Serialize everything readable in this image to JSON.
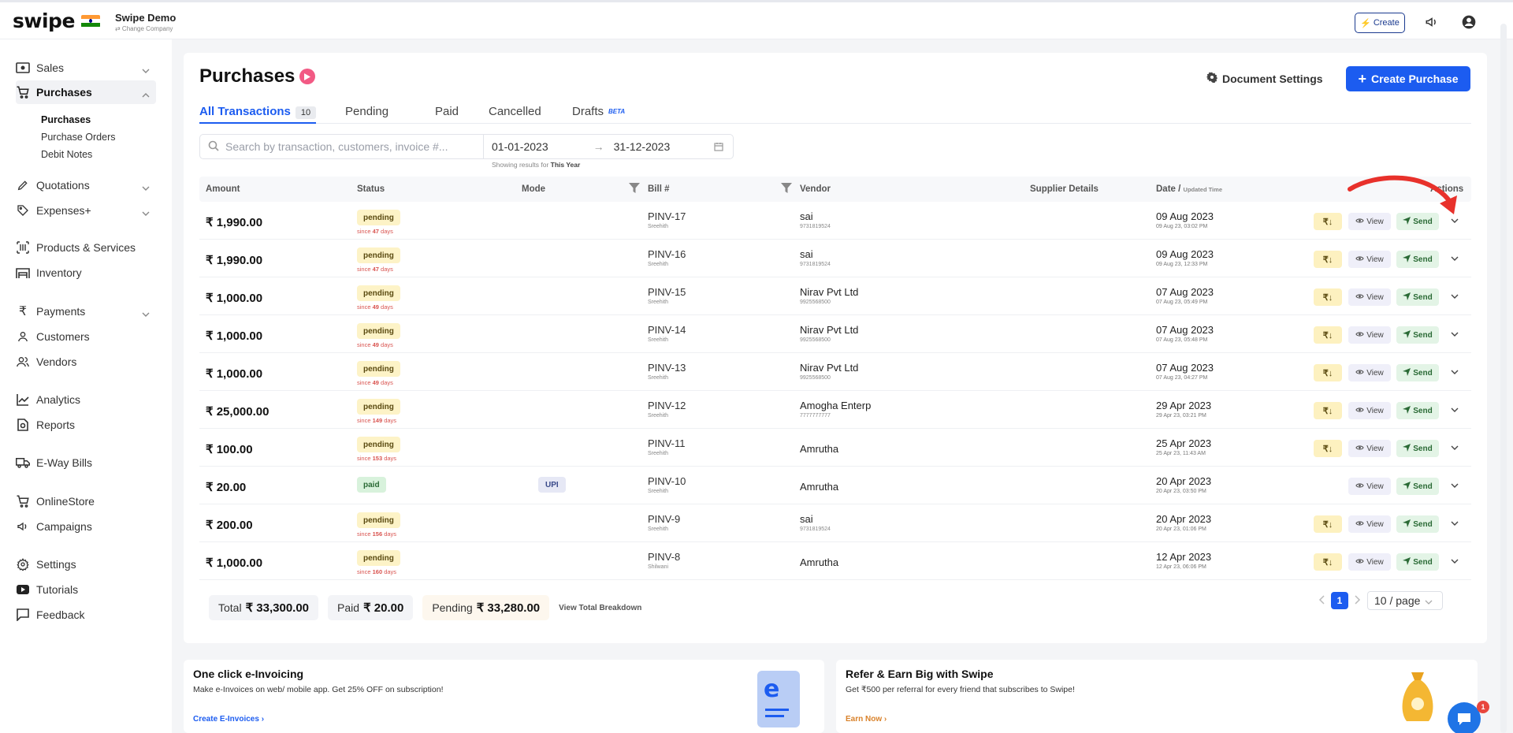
{
  "header": {
    "logo_text": "swipe",
    "company_name": "Swipe Demo",
    "change_company": "⇄ Change Company",
    "create_label": "Create"
  },
  "sidebar": {
    "sales": "Sales",
    "purchases": "Purchases",
    "sub_purchases": "Purchases",
    "sub_purchase_orders": "Purchase Orders",
    "sub_debit_notes": "Debit Notes",
    "quotations": "Quotations",
    "expenses": "Expenses+",
    "products": "Products & Services",
    "inventory": "Inventory",
    "payments": "Payments",
    "customers": "Customers",
    "vendors": "Vendors",
    "analytics": "Analytics",
    "reports": "Reports",
    "eway": "E-Way Bills",
    "onlinestore": "OnlineStore",
    "campaigns": "Campaigns",
    "settings": "Settings",
    "tutorials": "Tutorials",
    "feedback": "Feedback"
  },
  "page": {
    "title": "Purchases",
    "doc_settings": "Document Settings",
    "create_purchase": "Create Purchase"
  },
  "tabs": {
    "all": "All Transactions",
    "all_count": "10",
    "pending": "Pending",
    "paid": "Paid",
    "cancelled": "Cancelled",
    "drafts": "Drafts",
    "beta": "BETA"
  },
  "filters": {
    "search_placeholder": "Search by transaction, customers, invoice #...",
    "date_from": "01-01-2023",
    "date_to": "31-12-2023",
    "hint_prefix": "Showing results for",
    "hint_range": "This Year"
  },
  "columns": {
    "amount": "Amount",
    "status": "Status",
    "mode": "Mode",
    "bill": "Bill #",
    "vendor": "Vendor",
    "supplier": "Supplier Details",
    "date": "Date /",
    "date_small": "Updated Time",
    "actions": "Actions"
  },
  "actions": {
    "download": "₹↓",
    "view": "View",
    "send": "Send"
  },
  "rows": [
    {
      "amount": "₹ 1,990.00",
      "status": "pending",
      "since_prefix": "since",
      "since_days": "47",
      "since_suffix": "days",
      "mode": "",
      "bill": "PINV-17",
      "bill_by": "Sreehith",
      "vendor": "sai",
      "vendor_phone": "9731819524",
      "date": "09 Aug 2023",
      "time": "09 Aug 23, 03:02 PM"
    },
    {
      "amount": "₹ 1,990.00",
      "status": "pending",
      "since_prefix": "since",
      "since_days": "47",
      "since_suffix": "days",
      "mode": "",
      "bill": "PINV-16",
      "bill_by": "Sreehith",
      "vendor": "sai",
      "vendor_phone": "9731819524",
      "date": "09 Aug 2023",
      "time": "09 Aug 23, 12:33 PM"
    },
    {
      "amount": "₹ 1,000.00",
      "status": "pending",
      "since_prefix": "since",
      "since_days": "49",
      "since_suffix": "days",
      "mode": "",
      "bill": "PINV-15",
      "bill_by": "Sreehith",
      "vendor": "Nirav Pvt Ltd",
      "vendor_phone": "9925568500",
      "date": "07 Aug 2023",
      "time": "07 Aug 23, 05:49 PM"
    },
    {
      "amount": "₹ 1,000.00",
      "status": "pending",
      "since_prefix": "since",
      "since_days": "49",
      "since_suffix": "days",
      "mode": "",
      "bill": "PINV-14",
      "bill_by": "Sreehith",
      "vendor": "Nirav Pvt Ltd",
      "vendor_phone": "9925568500",
      "date": "07 Aug 2023",
      "time": "07 Aug 23, 05:48 PM"
    },
    {
      "amount": "₹ 1,000.00",
      "status": "pending",
      "since_prefix": "since",
      "since_days": "49",
      "since_suffix": "days",
      "mode": "",
      "bill": "PINV-13",
      "bill_by": "Sreehith",
      "vendor": "Nirav Pvt Ltd",
      "vendor_phone": "9925568500",
      "date": "07 Aug 2023",
      "time": "07 Aug 23, 04:27 PM"
    },
    {
      "amount": "₹ 25,000.00",
      "status": "pending",
      "since_prefix": "since",
      "since_days": "149",
      "since_suffix": "days",
      "mode": "",
      "bill": "PINV-12",
      "bill_by": "Sreehith",
      "vendor": "Amogha Enterp",
      "vendor_phone": "7777777777",
      "date": "29 Apr 2023",
      "time": "29 Apr 23, 03:21 PM"
    },
    {
      "amount": "₹ 100.00",
      "status": "pending",
      "since_prefix": "since",
      "since_days": "153",
      "since_suffix": "days",
      "mode": "",
      "bill": "PINV-11",
      "bill_by": "Sreehith",
      "vendor": "Amrutha",
      "vendor_phone": "",
      "date": "25 Apr 2023",
      "time": "25 Apr 23, 11:43 AM"
    },
    {
      "amount": "₹ 20.00",
      "status": "paid",
      "since_prefix": "",
      "since_days": "",
      "since_suffix": "",
      "mode": "UPI",
      "bill": "PINV-10",
      "bill_by": "Sreehith",
      "vendor": "Amrutha",
      "vendor_phone": "",
      "date": "20 Apr 2023",
      "time": "20 Apr 23, 03:50 PM"
    },
    {
      "amount": "₹ 200.00",
      "status": "pending",
      "since_prefix": "since",
      "since_days": "156",
      "since_suffix": "days",
      "mode": "",
      "bill": "PINV-9",
      "bill_by": "Sreehith",
      "vendor": "sai",
      "vendor_phone": "9731819524",
      "date": "20 Apr 2023",
      "time": "20 Apr 23, 01:06 PM"
    },
    {
      "amount": "₹ 1,000.00",
      "status": "pending",
      "since_prefix": "since",
      "since_days": "160",
      "since_suffix": "days",
      "mode": "",
      "bill": "PINV-8",
      "bill_by": "Shilwani",
      "vendor": "Amrutha",
      "vendor_phone": "",
      "date": "12 Apr 2023",
      "time": "12 Apr 23, 06:06 PM"
    }
  ],
  "totals": {
    "total_label": "Total",
    "total_value": "₹ 33,300.00",
    "paid_label": "Paid",
    "paid_value": "₹ 20.00",
    "pending_label": "Pending",
    "pending_value": "₹ 33,280.00",
    "breakdown": "View Total Breakdown"
  },
  "pagination": {
    "current": "1",
    "page_size": "10 / page"
  },
  "promos": {
    "einv_title": "One click e-Invoicing",
    "einv_text": "Make e-Invoices on web/ mobile app. Get 25% OFF on subscription!",
    "einv_link": "Create E-Invoices",
    "refer_title": "Refer & Earn Big with Swipe",
    "refer_text": "Get ₹500 per referral for every friend that subscribes to Swipe!",
    "refer_link": "Earn Now"
  },
  "chat": {
    "badge": "1"
  },
  "colors": {
    "primary": "#1c5cf0",
    "pending_bg": "#fdf3c7",
    "paid_bg": "#d8f2dc",
    "annotation_arrow": "#e8312b"
  }
}
